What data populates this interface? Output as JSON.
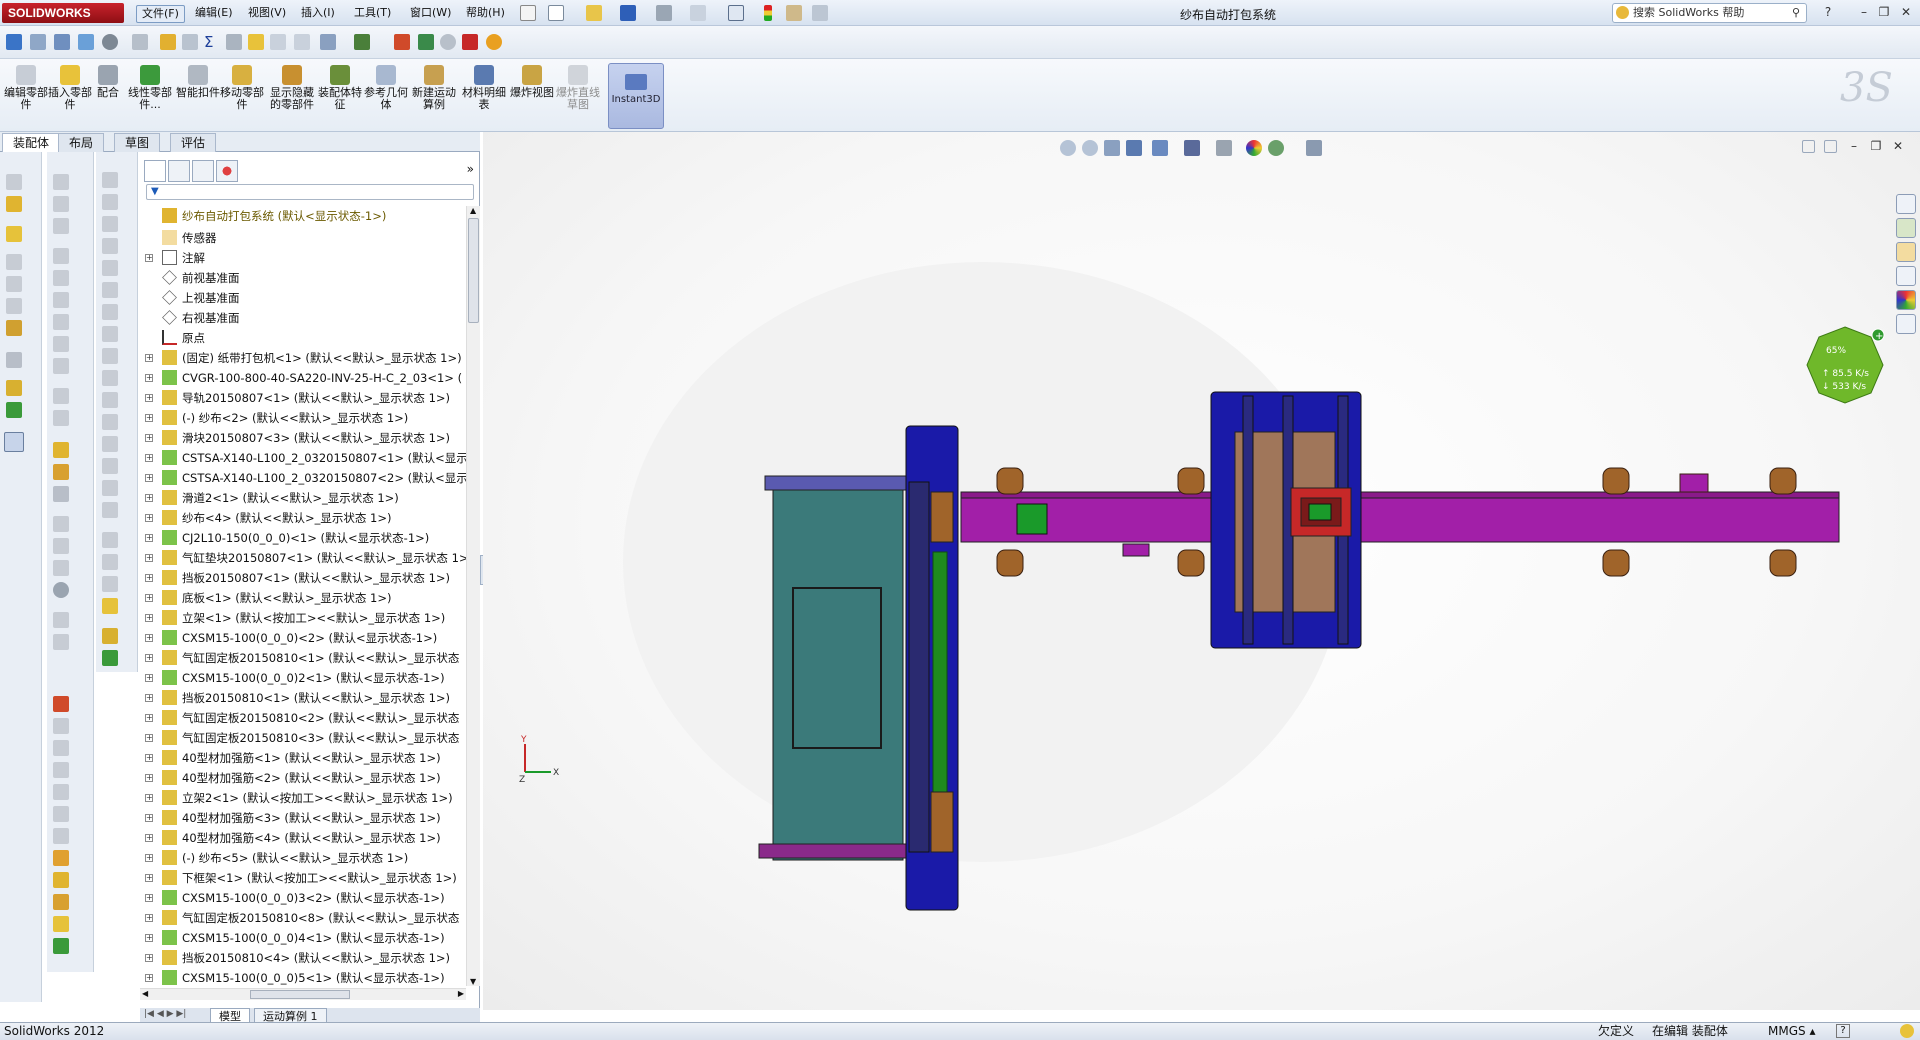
{
  "app": {
    "name": "SOLIDWORKS",
    "document_title": "纱布自动打包系统",
    "version": "SolidWorks 2012"
  },
  "menus": [
    "文件(F)",
    "编辑(E)",
    "视图(V)",
    "插入(I)",
    "工具(T)",
    "窗口(W)",
    "帮助(H)"
  ],
  "help_search": {
    "placeholder": "搜索 SolidWorks 帮助"
  },
  "command_manager": {
    "buttons": [
      {
        "label": "编辑零部件",
        "enabled": true
      },
      {
        "label": "插入零部件",
        "enabled": true
      },
      {
        "label": "配合",
        "enabled": true
      },
      {
        "label": "线性零部件...",
        "enabled": true
      },
      {
        "label": "智能扣件",
        "enabled": true
      },
      {
        "label": "移动零部件",
        "enabled": true
      },
      {
        "label": "显示隐藏的零部件",
        "enabled": true
      },
      {
        "label": "装配体特征",
        "enabled": true
      },
      {
        "label": "参考几何体",
        "enabled": true
      },
      {
        "label": "新建运动算例",
        "enabled": true
      },
      {
        "label": "材料明细表",
        "enabled": true
      },
      {
        "label": "爆炸视图",
        "enabled": true
      },
      {
        "label": "爆炸直线草图",
        "enabled": false
      }
    ],
    "instant3d": "Instant3D",
    "tabs": [
      "装配体",
      "布局",
      "草图",
      "评估"
    ]
  },
  "feature_tree": {
    "root": "纱布自动打包系统  (默认<显示状态-1>)",
    "items": [
      {
        "label": "传感器",
        "expand": false
      },
      {
        "label": "注解",
        "expand": true
      },
      {
        "label": "前视基准面",
        "expand": false
      },
      {
        "label": "上视基准面",
        "expand": false
      },
      {
        "label": "右视基准面",
        "expand": false
      },
      {
        "label": "原点",
        "expand": false
      },
      {
        "label": "(固定) 纸带打包机<1> (默认<<默认>_显示状态 1>)",
        "expand": true
      },
      {
        "label": "CVGR-100-800-40-SA220-INV-25-H-C_2_03<1> (",
        "expand": true
      },
      {
        "label": "导轨20150807<1> (默认<<默认>_显示状态 1>)",
        "expand": true
      },
      {
        "label": "(-) 纱布<2> (默认<<默认>_显示状态 1>)",
        "expand": true
      },
      {
        "label": "滑块20150807<3> (默认<<默认>_显示状态 1>)",
        "expand": true
      },
      {
        "label": "CSTSA-X140-L100_2_0320150807<1> (默认<显示",
        "expand": true
      },
      {
        "label": "CSTSA-X140-L100_2_0320150807<2> (默认<显示",
        "expand": true
      },
      {
        "label": "滑道2<1> (默认<<默认>_显示状态 1>)",
        "expand": true
      },
      {
        "label": "纱布<4> (默认<<默认>_显示状态 1>)",
        "expand": true
      },
      {
        "label": "CJ2L10-150(0_0_0)<1> (默认<显示状态-1>)",
        "expand": true
      },
      {
        "label": "气缸垫块20150807<1> (默认<<默认>_显示状态 1>",
        "expand": true
      },
      {
        "label": "挡板20150807<1> (默认<<默认>_显示状态 1>)",
        "expand": true
      },
      {
        "label": "底板<1> (默认<<默认>_显示状态 1>)",
        "expand": true
      },
      {
        "label": "立架<1> (默认<按加工><<默认>_显示状态 1>)",
        "expand": true
      },
      {
        "label": "CXSM15-100(0_0_0)<2> (默认<显示状态-1>)",
        "expand": true
      },
      {
        "label": "气缸固定板20150810<1> (默认<<默认>_显示状态",
        "expand": true
      },
      {
        "label": "CXSM15-100(0_0_0)2<1> (默认<显示状态-1>)",
        "expand": true
      },
      {
        "label": "挡板20150810<1> (默认<<默认>_显示状态 1>)",
        "expand": true
      },
      {
        "label": "气缸固定板20150810<2> (默认<<默认>_显示状态",
        "expand": true
      },
      {
        "label": "气缸固定板20150810<3> (默认<<默认>_显示状态",
        "expand": true
      },
      {
        "label": "40型材加强筋<1> (默认<<默认>_显示状态 1>)",
        "expand": true
      },
      {
        "label": "40型材加强筋<2> (默认<<默认>_显示状态 1>)",
        "expand": true
      },
      {
        "label": "立架2<1> (默认<按加工><<默认>_显示状态 1>)",
        "expand": true
      },
      {
        "label": "40型材加强筋<3> (默认<<默认>_显示状态 1>)",
        "expand": true
      },
      {
        "label": "40型材加强筋<4> (默认<<默认>_显示状态 1>)",
        "expand": true
      },
      {
        "label": "(-) 纱布<5> (默认<<默认>_显示状态 1>)",
        "expand": true
      },
      {
        "label": "下框架<1> (默认<按加工><<默认>_显示状态 1>)",
        "expand": true
      },
      {
        "label": "CXSM15-100(0_0_0)3<2> (默认<显示状态-1>)",
        "expand": true
      },
      {
        "label": "气缸固定板20150810<8> (默认<<默认>_显示状态",
        "expand": true
      },
      {
        "label": "CXSM15-100(0_0_0)4<1> (默认<显示状态-1>)",
        "expand": true
      },
      {
        "label": "挡板20150810<4> (默认<<默认>_显示状态 1>)",
        "expand": true
      },
      {
        "label": "CXSM15-100(0_0_0)5<1> (默认<显示状态-1>)",
        "expand": true
      }
    ]
  },
  "bottom_tabs": [
    "模型",
    "运动算例 1"
  ],
  "gauge": {
    "percent": "65%",
    "up": "85.5 K/s",
    "down": "533 K/s"
  },
  "status": {
    "left": "SolidWorks 2012",
    "underdefined": "欠定义",
    "editing": "在编辑 装配体",
    "units": "MMGS"
  },
  "colors": {
    "brand_red": "#c8232c",
    "frame_blue": "#1a1aa8",
    "teal": "#3b7a7a",
    "magenta": "#a21fa8",
    "brown": "#a0642a"
  }
}
